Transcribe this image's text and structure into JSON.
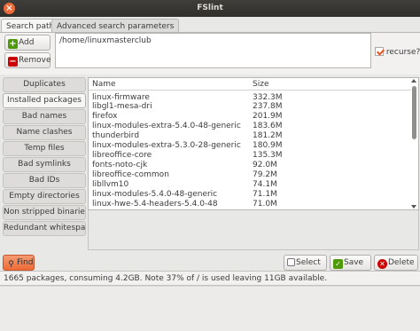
{
  "window": {
    "title": "FSlint"
  },
  "tabs": [
    {
      "label": "Search path",
      "active": true
    },
    {
      "label": "Advanced search parameters",
      "active": false
    }
  ],
  "search_path": {
    "add_label": "Add",
    "remove_label": "Remove",
    "paths": [
      "/home/linuxmasterclub"
    ],
    "recurse_label": "recurse?",
    "recurse_checked": true
  },
  "sidebar": {
    "items": [
      {
        "label": "Duplicates",
        "active": false
      },
      {
        "label": "Installed packages",
        "active": true
      },
      {
        "label": "Bad names",
        "active": false
      },
      {
        "label": "Name clashes",
        "active": false
      },
      {
        "label": "Temp files",
        "active": false
      },
      {
        "label": "Bad symlinks",
        "active": false
      },
      {
        "label": "Bad IDs",
        "active": false
      },
      {
        "label": "Empty directories",
        "active": false
      },
      {
        "label": "Non stripped binaries",
        "active": false
      },
      {
        "label": "Redundant whitespace",
        "active": false
      }
    ]
  },
  "results": {
    "columns": {
      "name": "Name",
      "size": "Size"
    },
    "rows": [
      {
        "name": "linux-firmware",
        "size": "332.3M"
      },
      {
        "name": "libgl1-mesa-dri",
        "size": "237.8M"
      },
      {
        "name": "firefox",
        "size": "201.9M"
      },
      {
        "name": "linux-modules-extra-5.4.0-48-generic",
        "size": "183.6M"
      },
      {
        "name": "thunderbird",
        "size": "181.2M"
      },
      {
        "name": "linux-modules-extra-5.3.0-28-generic",
        "size": "180.9M"
      },
      {
        "name": "libreoffice-core",
        "size": "135.3M"
      },
      {
        "name": "fonts-noto-cjk",
        "size": "92.0M"
      },
      {
        "name": "libreoffice-common",
        "size": "79.2M"
      },
      {
        "name": "libllvm10",
        "size": "74.1M"
      },
      {
        "name": "linux-modules-5.4.0-48-generic",
        "size": "71.1M"
      },
      {
        "name": "linux-hwe-5.4-headers-5.4.0-48",
        "size": "71.0M"
      }
    ]
  },
  "actions": {
    "find_label": "Find",
    "select_label": "Select",
    "save_label": "Save",
    "delete_label": "Delete"
  },
  "status": {
    "text": "1665 packages, consuming 4.2GB. Note 37% of / is used leaving 11GB available."
  },
  "colors": {
    "accent": "#e95420",
    "add_icon": "#4e9a06",
    "remove_icon": "#cc0000"
  }
}
